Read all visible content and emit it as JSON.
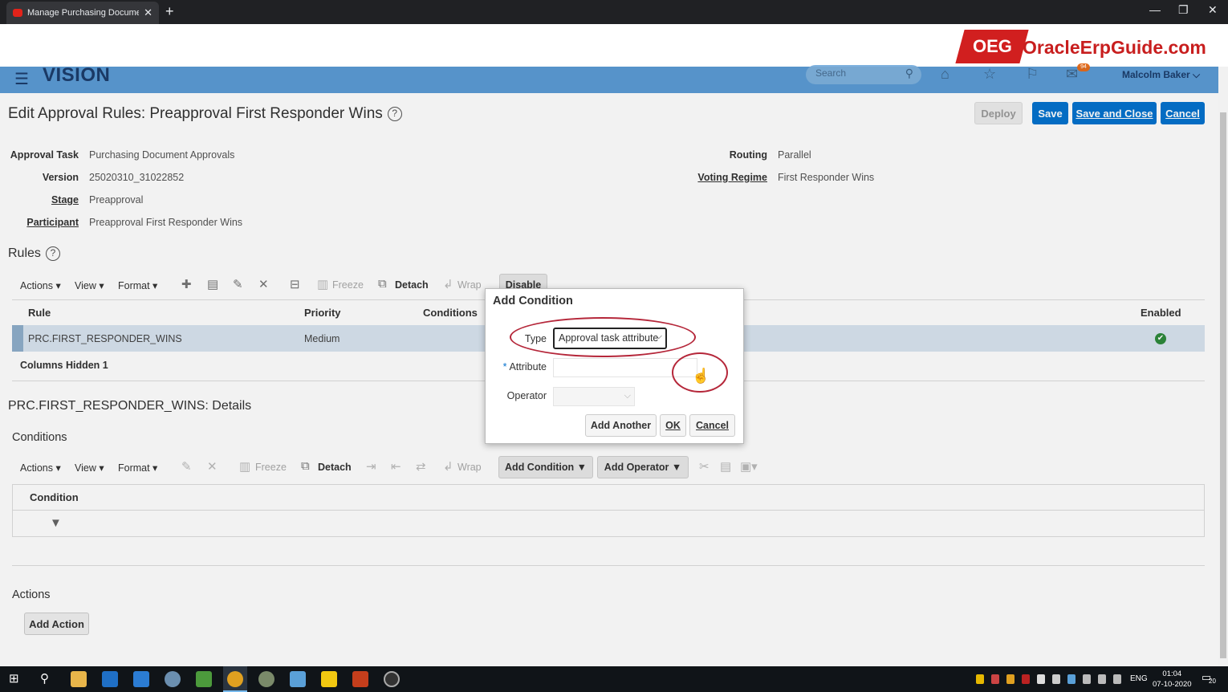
{
  "browser": {
    "tab_title": "Manage Purchasing Document A",
    "tab_close": "✕",
    "new_tab": "+",
    "minimize": "—",
    "restore": "❐",
    "close": "✕"
  },
  "banner": {
    "logo_mark": "OEG",
    "logo_text": "OracleErpGuide.com"
  },
  "header": {
    "menu_glyph": "☰",
    "brand": "VISION",
    "search_placeholder": "Search",
    "notification_count": "94",
    "user": "Malcolm Baker ⌵"
  },
  "page": {
    "title": "Edit Approval Rules: Preapproval First Responder Wins",
    "help": "?",
    "buttons": {
      "deploy": "Deploy",
      "save": "Save",
      "save_close": "Save and Close",
      "cancel": "Cancel"
    },
    "fields": {
      "approval_task_label": "Approval Task",
      "approval_task_value": "Purchasing Document Approvals",
      "version_label": "Version",
      "version_value": "25020310_31022852",
      "stage_label": "Stage",
      "stage_value": "Preapproval",
      "participant_label": "Participant",
      "participant_value": "Preapproval First Responder Wins",
      "routing_label": "Routing",
      "routing_value": "Parallel",
      "voting_label": "Voting Regime",
      "voting_value": "First Responder Wins"
    }
  },
  "rules": {
    "title": "Rules",
    "toolbar": {
      "actions": "Actions ▾",
      "view": "View ▾",
      "format": "Format ▾",
      "freeze": "Freeze",
      "detach": "Detach",
      "wrap": "Wrap",
      "disable": "Disable"
    },
    "columns": {
      "rule": "Rule",
      "priority": "Priority",
      "conditions": "Conditions",
      "enabled": "Enabled"
    },
    "rows": [
      {
        "rule": "PRC.FIRST_RESPONDER_WINS",
        "priority": "Medium",
        "enabled": "✔"
      }
    ],
    "columns_hidden": "Columns Hidden  1"
  },
  "details": {
    "title": "PRC.FIRST_RESPONDER_WINS: Details",
    "conditions_title": "Conditions",
    "toolbar": {
      "actions": "Actions ▾",
      "view": "View ▾",
      "format": "Format ▾",
      "freeze": "Freeze",
      "detach": "Detach",
      "wrap": "Wrap",
      "add_condition": "Add Condition ▼",
      "add_operator": "Add Operator ▼"
    },
    "condition_column": "Condition",
    "actions_title": "Actions",
    "add_action": "Add Action"
  },
  "dialog": {
    "title": "Add Condition",
    "type_label": "Type",
    "type_value": "Approval task attribute",
    "attribute_label": "Attribute",
    "required_mark": "*",
    "operator_label": "Operator",
    "add_another": "Add Another",
    "ok": "OK",
    "cancel": "Cancel"
  },
  "taskbar": {
    "lang": "ENG",
    "time": "01:04",
    "date": "07-10-2020",
    "notifications": "20"
  },
  "colors": {
    "header_bg": "#5b9bd5",
    "primary_button": "#0572ce",
    "annotation_ring": "#b5273a",
    "logo_red": "#d11f1f"
  }
}
